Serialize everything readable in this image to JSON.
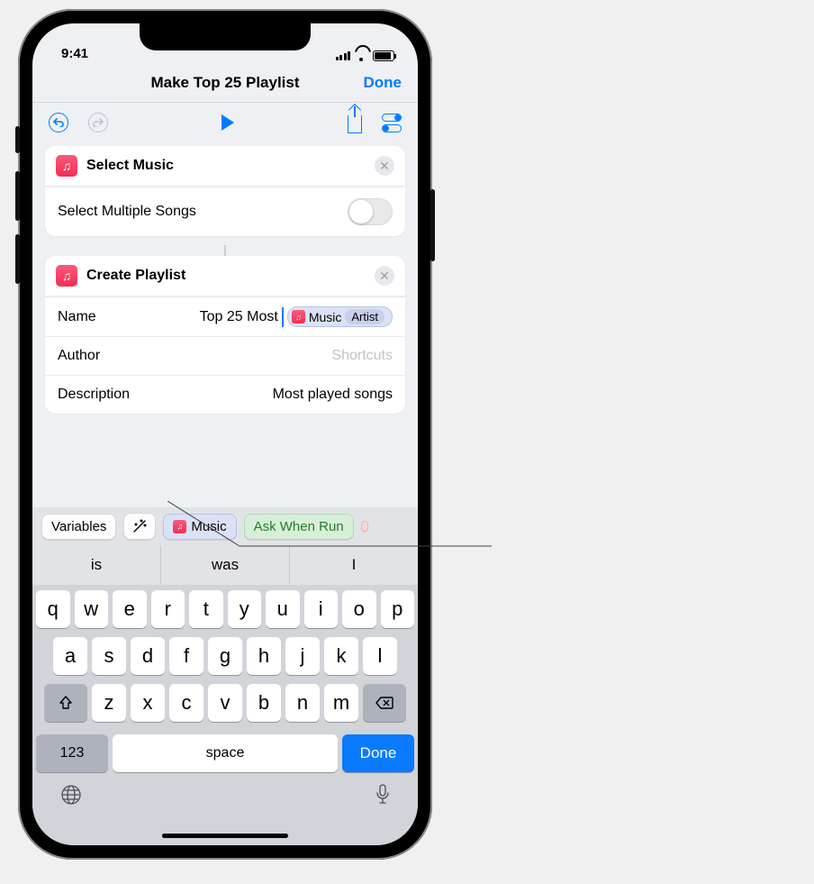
{
  "status": {
    "time": "9:41"
  },
  "nav": {
    "title": "Make Top 25 Playlist",
    "done": "Done"
  },
  "actions": {
    "select": {
      "title": "Select Music",
      "row_label": "Select Multiple Songs"
    },
    "create": {
      "title": "Create Playlist",
      "name_label": "Name",
      "name_value": "Top 25 Most",
      "name_token": "Music",
      "name_token_sub": "Artist",
      "author_label": "Author",
      "author_placeholder": "Shortcuts",
      "desc_label": "Description",
      "desc_value": "Most played songs"
    }
  },
  "varbar": {
    "variables": "Variables",
    "music": "Music",
    "ask": "Ask When Run"
  },
  "suggestions": [
    "is",
    "was",
    "I"
  ],
  "keyboard": {
    "row1": [
      "q",
      "w",
      "e",
      "r",
      "t",
      "y",
      "u",
      "i",
      "o",
      "p"
    ],
    "row2": [
      "a",
      "s",
      "d",
      "f",
      "g",
      "h",
      "j",
      "k",
      "l"
    ],
    "row3": [
      "z",
      "x",
      "c",
      "v",
      "b",
      "n",
      "m"
    ],
    "num": "123",
    "space": "space",
    "done": "Done"
  }
}
